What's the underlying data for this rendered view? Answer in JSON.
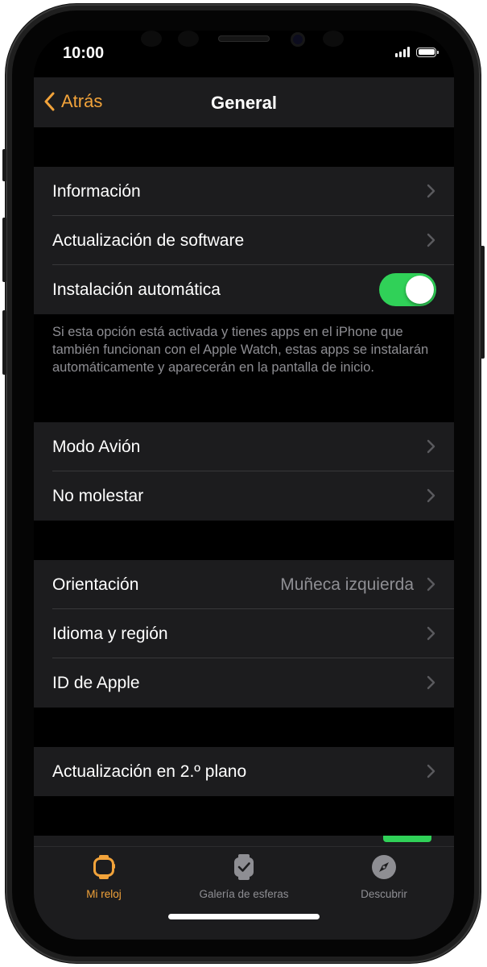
{
  "status": {
    "time": "10:00"
  },
  "navbar": {
    "back_label": "Atrás",
    "title": "General"
  },
  "sections": {
    "general1": [
      {
        "label": "Información"
      },
      {
        "label": "Actualización de software"
      },
      {
        "label": "Instalación automática",
        "toggle": true
      }
    ],
    "footnote": "Si esta opción está activada y tienes apps en el iPhone que también funcionan con el Apple Watch, estas apps se instalarán automáticamente y aparecerán en la pantalla de inicio.",
    "general2": [
      {
        "label": "Modo Avión"
      },
      {
        "label": "No molestar"
      }
    ],
    "general3": [
      {
        "label": "Orientación",
        "value": "Muñeca izquierda"
      },
      {
        "label": "Idioma y región"
      },
      {
        "label": "ID de Apple"
      }
    ],
    "general4": [
      {
        "label": "Actualización en 2.º plano"
      }
    ]
  },
  "tabbar": {
    "tabs": [
      {
        "label": "Mi reloj",
        "active": true
      },
      {
        "label": "Galería de esferas",
        "active": false
      },
      {
        "label": "Descubrir",
        "active": false
      }
    ]
  },
  "colors": {
    "accent": "#f2a33a",
    "toggle_on": "#30d158",
    "cell_bg": "#1c1c1e",
    "secondary_text": "#8e8e93"
  }
}
